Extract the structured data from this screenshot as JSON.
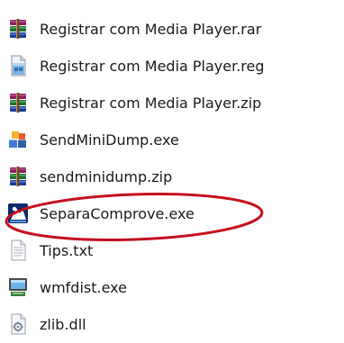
{
  "files": [
    {
      "name": "Registrar com Media Player.rar",
      "icon": "winrar-archive-icon"
    },
    {
      "name": "Registrar com Media Player.reg",
      "icon": "registry-file-icon"
    },
    {
      "name": "Registrar com Media Player.zip",
      "icon": "winrar-archive-icon"
    },
    {
      "name": "SendMiniDump.exe",
      "icon": "application-exe-icon"
    },
    {
      "name": "sendminidump.zip",
      "icon": "winrar-archive-icon"
    },
    {
      "name": "SeparaComprove.exe",
      "icon": "blue-app-icon"
    },
    {
      "name": "Tips.txt",
      "icon": "text-document-icon"
    },
    {
      "name": "wmfdist.exe",
      "icon": "installer-exe-icon"
    },
    {
      "name": "zlib.dll",
      "icon": "dll-file-icon"
    }
  ],
  "highlight": {
    "target": "SeparaComprove.exe",
    "color": "#c4101e"
  }
}
